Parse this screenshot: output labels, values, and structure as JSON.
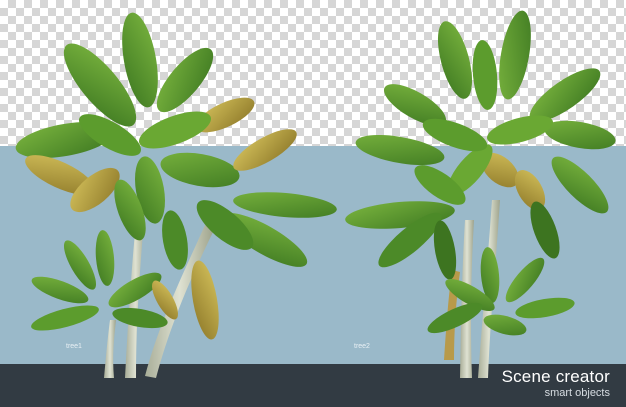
{
  "scene": {
    "tree_labels": [
      "tree1",
      "tree2"
    ]
  },
  "branding": {
    "title": "Scene creator",
    "subtitle": "smart objects"
  },
  "colors": {
    "background_blue": "#9ab9c9",
    "footer": "#323b43",
    "leaf_green": "#5e9a2e",
    "leaf_dark": "#3d7420",
    "leaf_yellow": "#b7a244",
    "trunk": "#c9cdb8"
  }
}
